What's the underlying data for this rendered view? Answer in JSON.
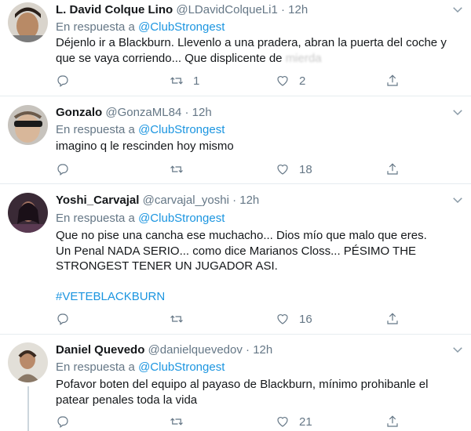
{
  "tweets": [
    {
      "name": "L. David Colque Lino",
      "handle": "@LDavidColqueLi1",
      "time": "12h",
      "reply_prefix": "En respuesta a ",
      "reply_to": "@ClubStrongest",
      "text_lines": [
        "Déjenlo ir a Blackburn. Llevenlo a una pradera, abran la puerta del coche y",
        "que se vaya corriendo... Que displicente de "
      ],
      "censored": "mierda",
      "replies": "",
      "retweets": "1",
      "likes": "2"
    },
    {
      "name": "Gonzalo",
      "handle": "@GonzaML84",
      "time": "12h",
      "reply_prefix": "En respuesta a ",
      "reply_to": "@ClubStrongest",
      "text_lines": [
        "imagino q le rescinden hoy mismo"
      ],
      "replies": "",
      "retweets": "",
      "likes": "18"
    },
    {
      "name": "Yoshi_Carvajal",
      "handle": "@carvajal_yoshi",
      "time": "12h",
      "reply_prefix": "En respuesta a ",
      "reply_to": "@ClubStrongest",
      "text_lines": [
        "Que no pise una cancha ese muchacho... Dios mío que malo que eres.",
        "Un Penal NADA SERIO... como dice Marianos Closs... PÉSIMO THE",
        "STRONGEST TENER UN JUGADOR ASI."
      ],
      "hashtag": "#VETEBLACKBURN",
      "replies": "",
      "retweets": "",
      "likes": "16"
    },
    {
      "name": "Daniel Quevedo",
      "handle": "@danielquevedov",
      "time": "12h",
      "reply_prefix": "En respuesta a ",
      "reply_to": "@ClubStrongest",
      "text_lines": [
        "Pofavor boten del equipo al payaso de Blackburn, mínimo prohibanle el",
        "patear penales toda la vida"
      ],
      "replies": "",
      "retweets": "",
      "likes": "21"
    }
  ],
  "icons": {
    "reply": "reply-icon",
    "retweet": "retweet-icon",
    "like": "heart-icon",
    "share": "share-icon",
    "more": "chevron-down-icon"
  },
  "colors": {
    "link": "#1b95e0",
    "secondary": "#657786",
    "text": "#14171a",
    "divider": "#e6ecf0"
  }
}
